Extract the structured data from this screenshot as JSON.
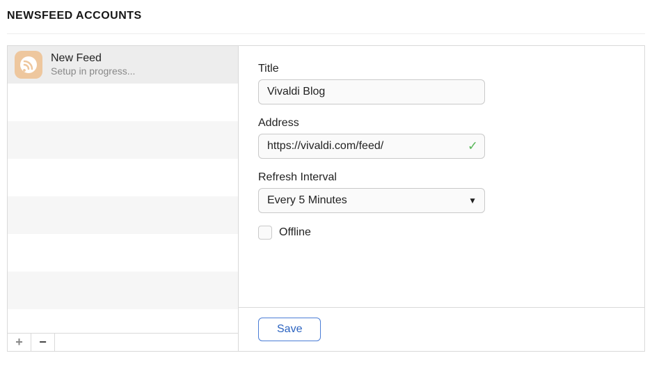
{
  "header": {
    "title": "NEWSFEED ACCOUNTS"
  },
  "feedList": {
    "selected": {
      "title": "New Feed",
      "subtitle": "Setup in progress..."
    },
    "toolbar": {
      "add": "+",
      "remove": "−"
    }
  },
  "form": {
    "titleLabel": "Title",
    "titleValue": "Vivaldi Blog",
    "addressLabel": "Address",
    "addressValue": "https://vivaldi.com/feed/",
    "addressValid": true,
    "refreshLabel": "Refresh Interval",
    "refreshValue": "Every 5 Minutes",
    "offlineLabel": "Offline",
    "offlineChecked": false,
    "saveLabel": "Save"
  },
  "icons": {
    "checkmark": "✓",
    "caretDown": "▼"
  }
}
